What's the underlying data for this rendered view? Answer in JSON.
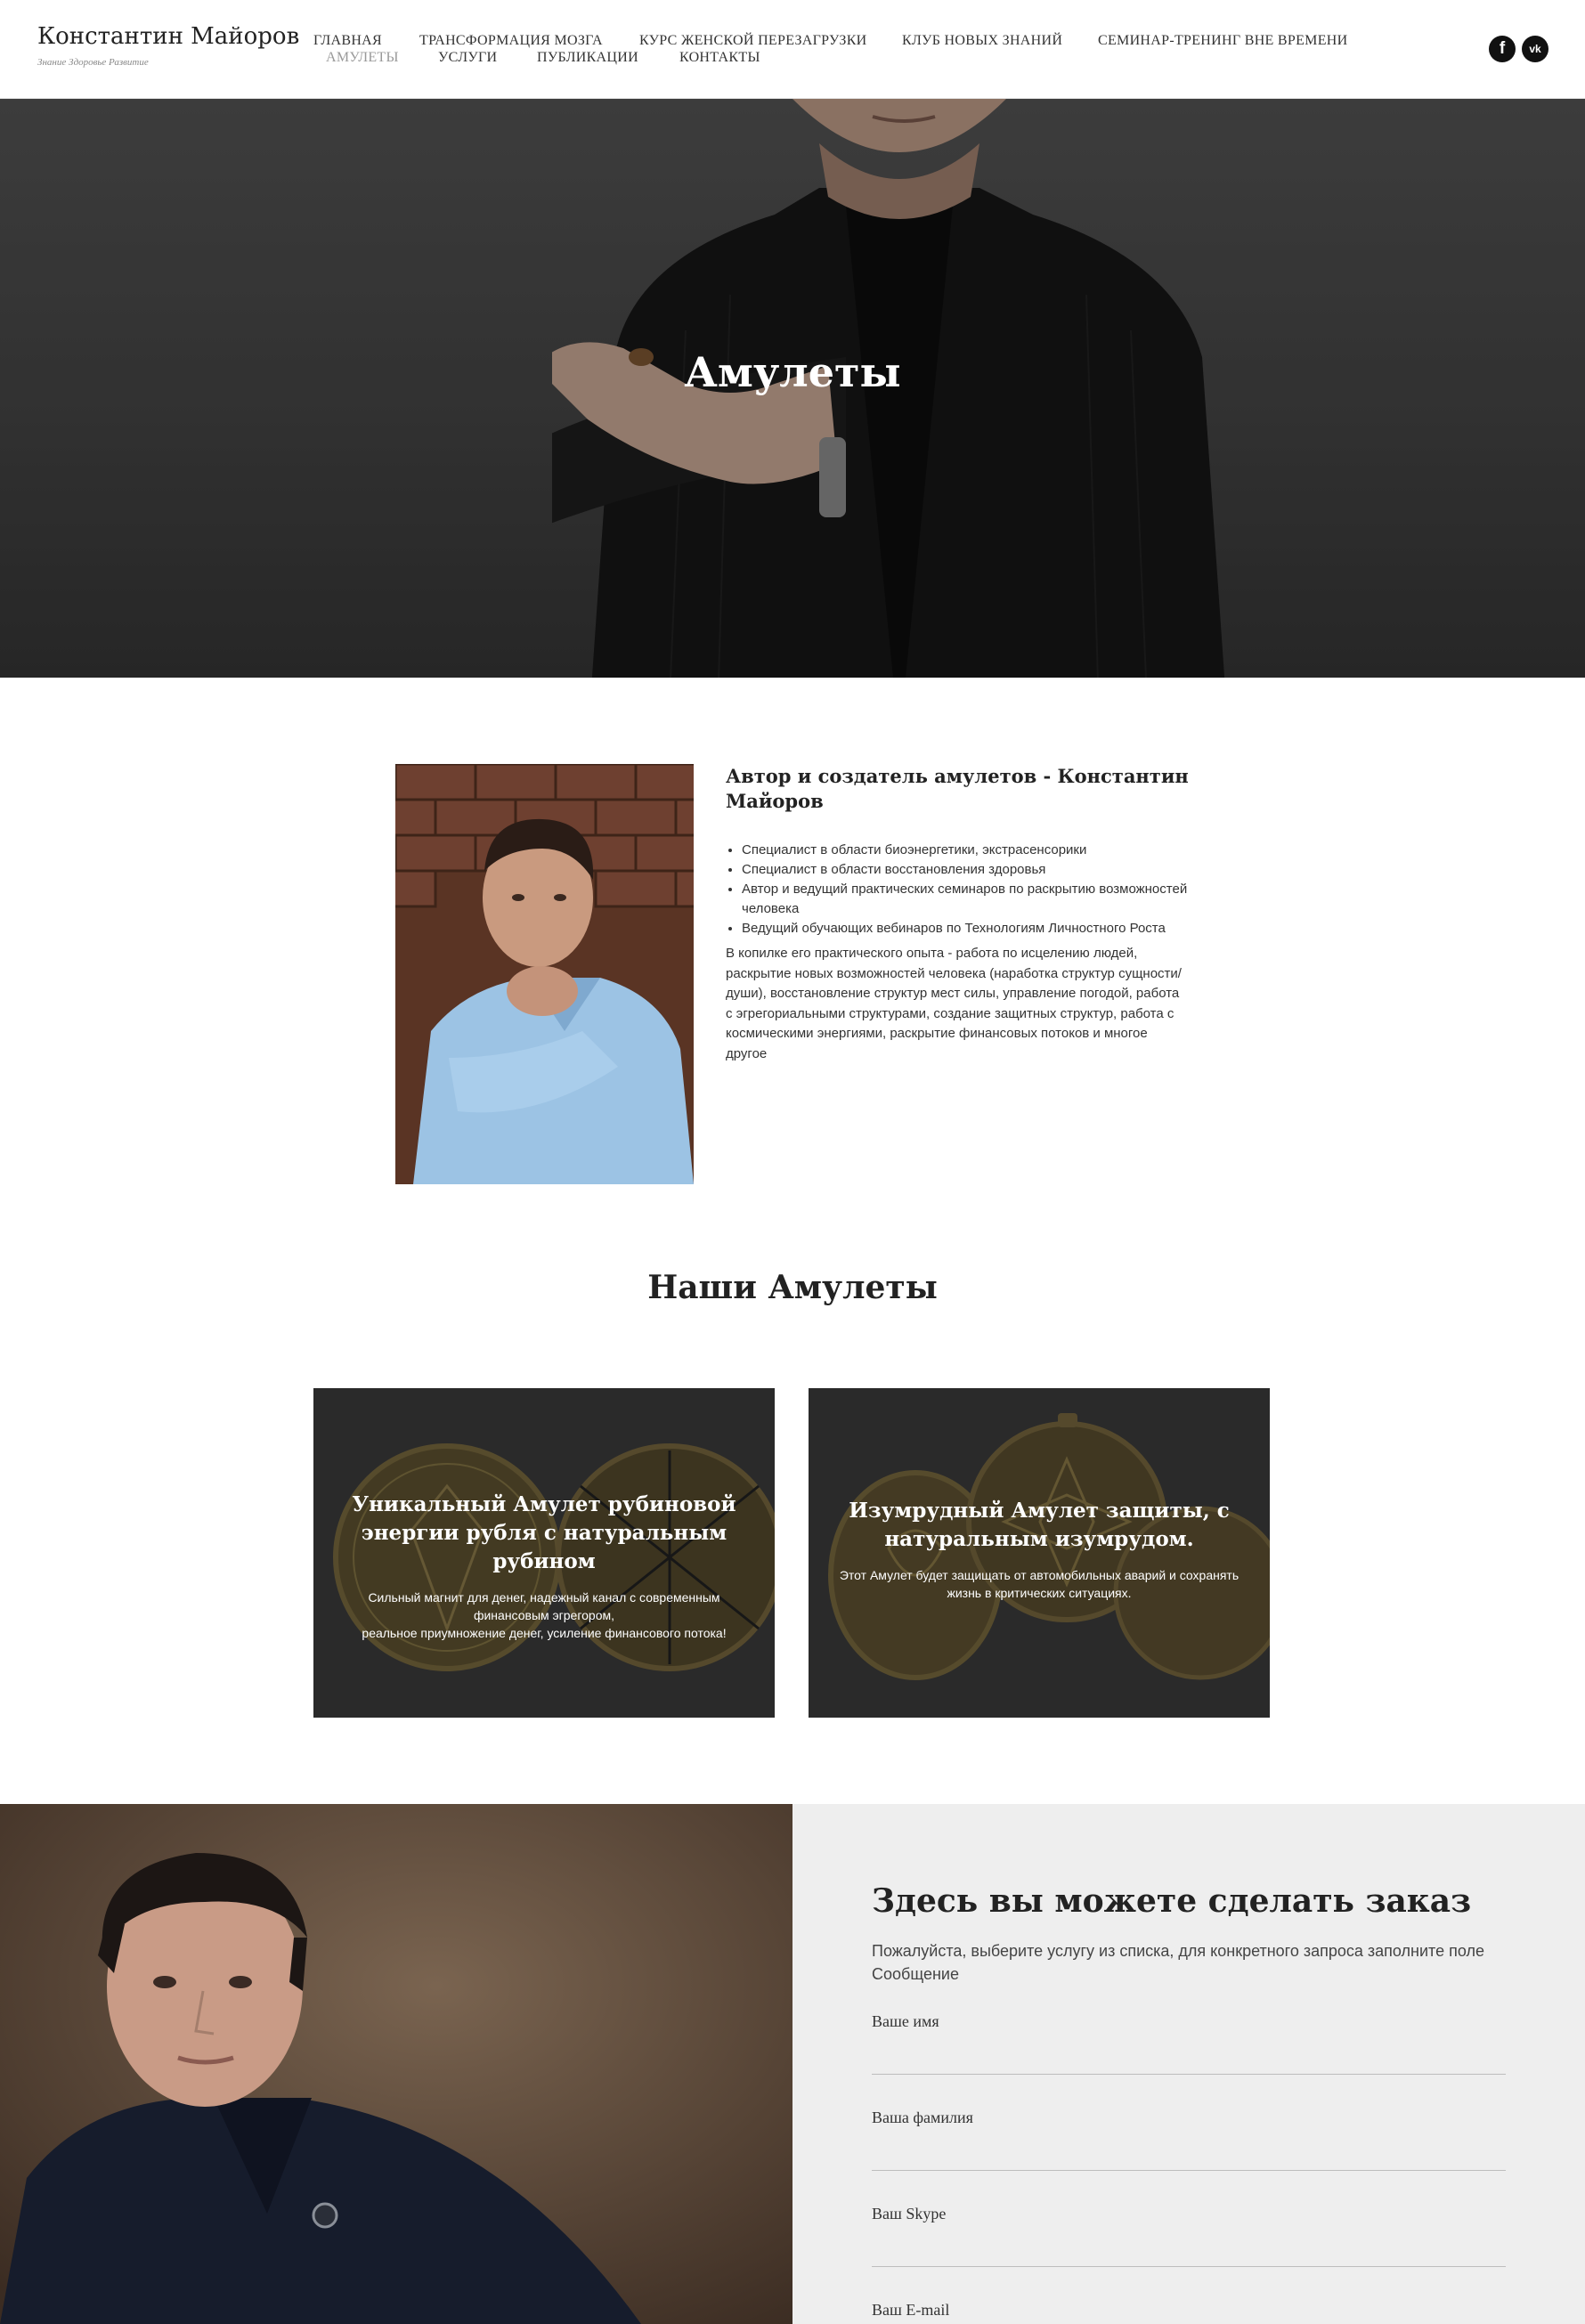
{
  "header": {
    "logo_name": "Константин Майоров",
    "logo_tagline": "Знание Здоровье Развитие",
    "nav_row1": [
      "ГЛАВНАЯ",
      "ТРАНСФОРМАЦИЯ МОЗГА",
      "КУРС ЖЕНСКОЙ ПЕРЕЗАГРУЗКИ",
      "КЛУБ НОВЫХ ЗНАНИЙ",
      "СЕМИНАР-ТРЕНИНГ ВНЕ ВРЕМЕНИ"
    ],
    "nav_row2": [
      "АМУЛЕТЫ",
      "УСЛУГИ",
      "ПУБЛИКАЦИИ",
      "КОНТАКТЫ"
    ],
    "active_item": "АМУЛЕТЫ",
    "social": [
      {
        "name": "facebook-icon",
        "glyph": "f"
      },
      {
        "name": "vk-icon",
        "glyph": "vk"
      }
    ]
  },
  "hero": {
    "title": "Амулеты"
  },
  "author": {
    "heading": "Автор и создатель амулетов - Константин Майоров",
    "list": [
      "Специалист в области биоэнергетики, экстрасенсорики",
      "Специалист в области восстановления здоровья",
      "Автор и ведущий практических семинаров по раскрытию возможностей человека",
      "Ведущий обучающих вебинаров по Технологиям Личностного Роста"
    ],
    "paragraph": "В копилке его практического опыта - работа по исцелению людей, раскрытие новых возможностей человека (наработка структур сущности/души), восстановление структур мест силы, управление погодой, работа с эгрегориальными структурами, создание защитных структур, работа с космическими энергиями, раскрытие финансовых потоков и многое другое"
  },
  "amulets": {
    "title": "Наши Амулеты",
    "cards": [
      {
        "title": "Уникальный Амулет рубиновой энергии рубля с натуральным рубином",
        "description": "Сильный магнит для денег, надежный канал с современным финансовым эгрегором,",
        "description2": "реальное приумножение денег, усиление финансового потока!"
      },
      {
        "title": "Изумрудный Амулет защиты, с натуральным изумрудом.",
        "description": "Этот Амулет будет защищать от автомобильных аварий и сохранять жизнь в критических ситуациях.",
        "description2": ""
      }
    ]
  },
  "order": {
    "title": "Здесь вы можете сделать заказ",
    "subtitle": "Пожалуйста, выберите услугу из списка, для конкретного запроса заполните поле Сообщение",
    "fields": [
      "Ваше имя",
      "Ваша фамилия",
      "Ваш Skype",
      "Ваш E-mail"
    ]
  },
  "colors": {
    "hero_bg": "#3c3c3c",
    "order_panel_bg": "#eeeeee",
    "nav_active": "#999999",
    "social_bg": "#111111"
  }
}
